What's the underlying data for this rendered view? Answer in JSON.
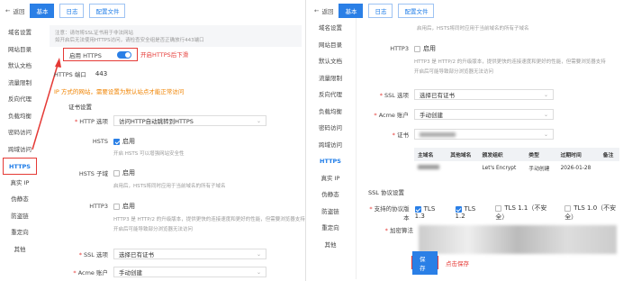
{
  "left": {
    "back": "返回",
    "tabs": [
      "基本",
      "日志",
      "配置文件"
    ],
    "sidebar": [
      "域名设置",
      "网站目录",
      "默认文档",
      "流量限制",
      "反向代理",
      "负载均衡",
      "密码访问",
      "跨域访问",
      "HTTPS",
      "真实 IP",
      "伪静态",
      "防盗链",
      "重定向",
      "其他"
    ],
    "notice1": "注意：请勿将SSL证书用于非法网站",
    "notice2": "如开启后无法使用HTTPS访问，请检查安全组是否正确放行443端口",
    "enable_https_label": "启用 HTTPS",
    "annot_enable": "开启HTTPS后下滑",
    "https_port_label": "HTTPS 端口",
    "https_port_value": "443",
    "ipv6_warning": "IP 方式的网站，需要设置为默认站点才能正常访问",
    "cert_settings": "证书设置",
    "http_option_label": "HTTP 选项",
    "http_option_value": "访问HTTP自动跳转到HTTPS",
    "hsts_label": "HSTS",
    "hsts_enable": "启用",
    "hsts_hint": "开启 HSTS 可以增强网站安全性",
    "hsts_sub_label": "HSTS 子域",
    "hsts_sub_enable": "启用",
    "hsts_sub_hint": "启用后，HSTS将同时应用于当前域名的所有子域名",
    "http3_label": "HTTP3",
    "http3_enable": "启用",
    "http3_hint1": "HTTP3 是 HTTP/2 的升级版本，提供更快的连接速度和更好的性能，但需要浏览器支持",
    "http3_hint2": "开启后可能导致部分浏览器无法访问",
    "ssl_label": "SSL 选项",
    "ssl_value": "选择已有证书",
    "acme_label": "Acme 账户",
    "acme_value": "手动创建"
  },
  "right": {
    "back": "返回",
    "tabs": [
      "基本",
      "日志",
      "配置文件"
    ],
    "sidebar": [
      "域名设置",
      "网站目录",
      "默认文档",
      "流量限制",
      "反向代理",
      "负载均衡",
      "密码访问",
      "跨域访问",
      "HTTPS",
      "真实 IP",
      "伪静态",
      "防盗链",
      "重定向",
      "其他"
    ],
    "top_hint": "启用后，HSTS将同时应用于当前域名的所有子域名",
    "http3_label": "HTTP3",
    "http3_enable": "启用",
    "http3_hint1": "HTTP3 是 HTTP/2 的升级版本，提供更快的连接速度和更好的性能，但需要浏览器支持",
    "http3_hint2": "开启后可能导致部分浏览器无法访问",
    "ssl_label": "SSL 选项",
    "ssl_value": "选择已有证书",
    "acme_label": "Acme 账户",
    "acme_value": "手动创建",
    "cert_label": "证书",
    "table_headers": [
      "主域名",
      "其他域名",
      "颁发组织",
      "类型",
      "过期时间",
      "备注"
    ],
    "table_row": [
      "",
      "",
      "Let's Encrypt",
      "手动创建",
      "2026-01-28",
      ""
    ],
    "ssl_protocol_title": "SSL 协议设置",
    "protocol_label": "支持的协议版本",
    "protocols": [
      "TLS 1.3",
      "TLS 1.2",
      "TLS 1.1（不安全）",
      "TLS 1.0（不安全）"
    ],
    "cipher_label": "加密算法",
    "save_label": "保存",
    "annot_save": "点击保存"
  }
}
